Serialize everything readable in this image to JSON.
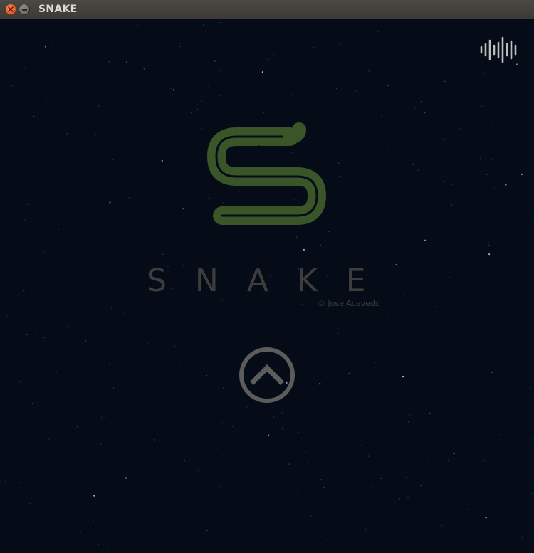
{
  "window": {
    "title": "SNAKE",
    "controls": [
      "close",
      "minimize"
    ]
  },
  "game": {
    "title": "SNAKE",
    "copyright": "© Jose Acevedo",
    "logo_icon": "snake-s-logo",
    "start_icon": "chevron-up-circle-icon",
    "sound_icon": "sound-wave-icon"
  },
  "colors": {
    "background": "#050c18",
    "logo": "#3a5527",
    "title_text": "#3e3d3c",
    "start_button": "#5c5c5c",
    "sound_icon": "#bdbdbd"
  }
}
